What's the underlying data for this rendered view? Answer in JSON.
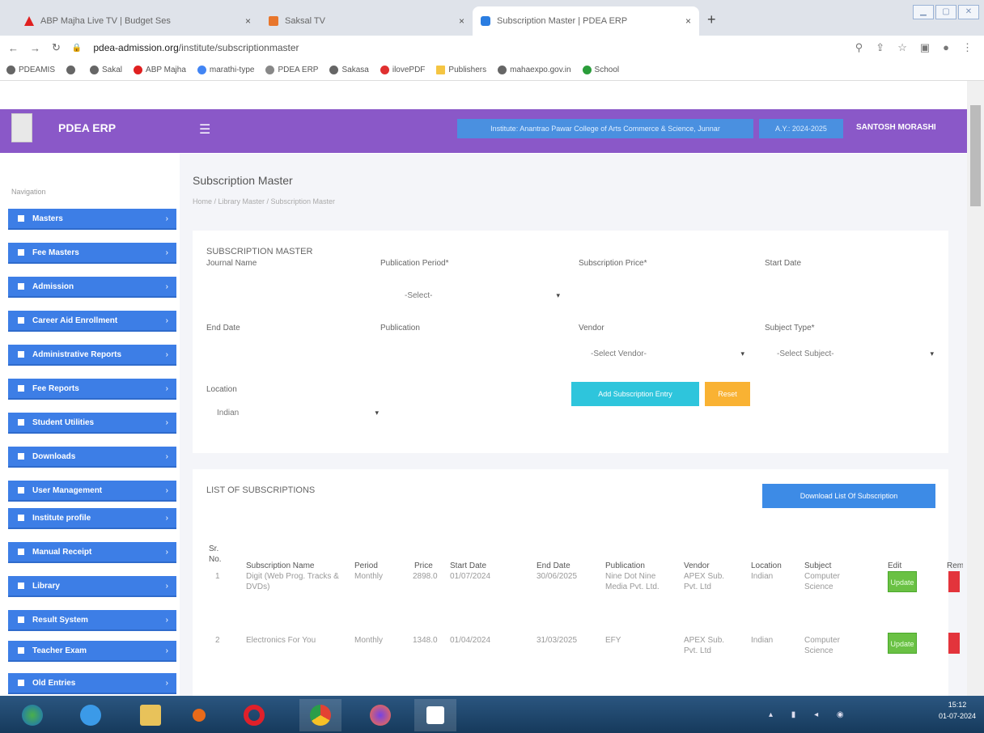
{
  "browser": {
    "tabs": [
      {
        "title": "ABP Majha Live TV | Budget Ses",
        "close": "×"
      },
      {
        "title": "Saksal TV",
        "close": "×"
      },
      {
        "title": "Subscription Master | PDEA ERP",
        "close": "×"
      }
    ],
    "new_tab": "+",
    "url_domain": "pdea-admission.org",
    "url_path": "/institute/subscriptionmaster",
    "bookmarks": [
      "PDEAMIS",
      "",
      "Sakal",
      "ABP Majha",
      "marathi-type",
      "PDEA ERP",
      "Sakasa",
      "ilovePDF",
      "Publishers",
      "mahaexpo.gov.in",
      "School"
    ]
  },
  "app": {
    "brand": "PDEA ERP",
    "institute": "Institute: Anantrao Pawar College of Arts Commerce & Science, Junnar",
    "academic_year": "A.Y.: 2024-2025",
    "user": "SANTOSH MORASHI",
    "nav_label": "Navigation"
  },
  "sidebar": [
    "Masters",
    "Fee Masters",
    "Admission",
    "Career Aid Enrollment",
    "Administrative Reports",
    "Fee Reports",
    "Student Utilities",
    "Downloads",
    "User Management",
    "Institute profile",
    "Manual Receipt",
    "Library",
    "Result System",
    "Teacher Exam",
    "Old Entries"
  ],
  "page": {
    "title": "Subscription Master",
    "breadcrumb": "Home  /  Library Master  /  Subscription Master"
  },
  "form": {
    "heading": "SUBSCRIPTION MASTER",
    "journal_name": "Journal Name",
    "publication_period": "Publication Period*",
    "period_value": "-Select-",
    "subscription_price": "Subscription Price*",
    "start_date": "Start Date",
    "end_date": "End Date",
    "publication": "Publication",
    "vendor": "Vendor",
    "vendor_value": "-Select Vendor-",
    "subject_type": "Subject Type*",
    "subject_value": "-Select Subject-",
    "location": "Location",
    "location_value": "Indian",
    "add_button": "Add Subscription Entry",
    "reset_button": "Reset"
  },
  "list": {
    "heading": "LIST OF SUBSCRIPTIONS",
    "download_button": "Download List Of Subscription",
    "headers": [
      "Sr. No.",
      "Subscription Name",
      "Period",
      "Price",
      "Start Date",
      "End Date",
      "Publication",
      "Vendor",
      "Location",
      "Subject",
      "Edit",
      "Rem"
    ],
    "rows": [
      {
        "sr": "1",
        "name": "Digit (Web Prog. Tracks & DVDs)",
        "period": "Monthly",
        "price": "2898.0",
        "start": "01/07/2024",
        "end": "30/06/2025",
        "publication": "Nine Dot Nine Media Pvt. Ltd.",
        "vendor": "APEX Sub. Pvt. Ltd",
        "location": "Indian",
        "subject": "Computer Science",
        "edit": "Update"
      },
      {
        "sr": "2",
        "name": "Electronics For You",
        "period": "Monthly",
        "price": "1348.0",
        "start": "01/04/2024",
        "end": "31/03/2025",
        "publication": "EFY",
        "vendor": "APEX Sub. Pvt. Ltd",
        "location": "Indian",
        "subject": "Computer Science",
        "edit": "Update"
      }
    ]
  },
  "taskbar": {
    "time": "15:12",
    "date": "01-07-2024"
  },
  "colors": {
    "header": "#8a58c8",
    "nav": "#3d7ee6",
    "add": "#2ec5dc",
    "reset": "#f9b233",
    "update": "#6ac144",
    "delete": "#e3343c"
  }
}
